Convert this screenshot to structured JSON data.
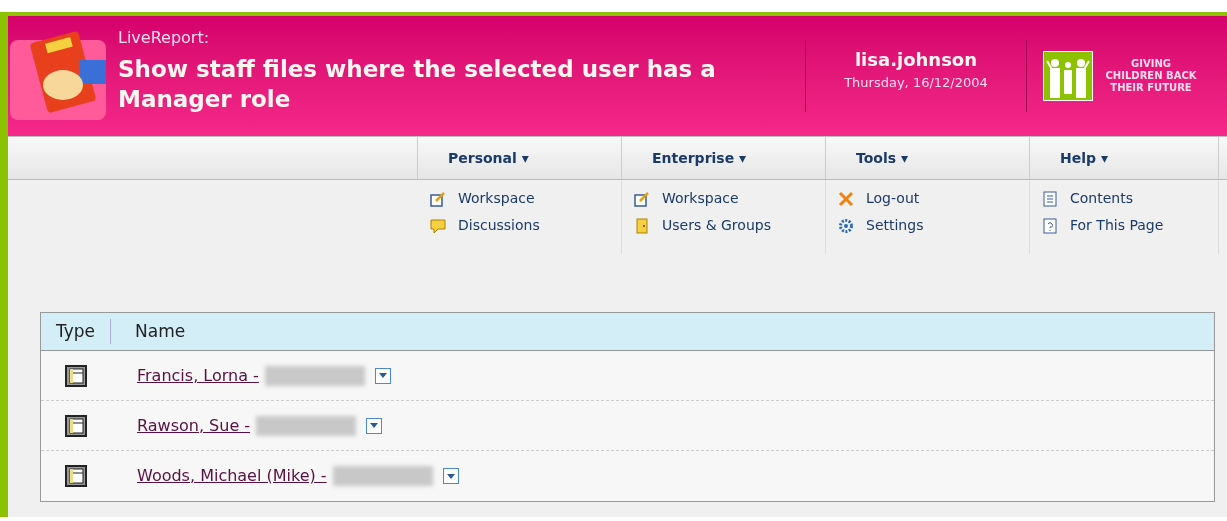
{
  "header": {
    "app": "LiveReport:",
    "title": "Show staff files where the selected user has a Manager role",
    "user": "lisa.johnson",
    "date": "Thursday, 16/12/2004",
    "logo_text": "GIVING CHILDREN BACK THEIR FUTURE"
  },
  "menus": [
    {
      "label": "Personal ▾",
      "items": [
        {
          "label": "Workspace"
        },
        {
          "label": "Discussions"
        }
      ]
    },
    {
      "label": "Enterprise ▾",
      "items": [
        {
          "label": "Workspace"
        },
        {
          "label": "Users & Groups"
        }
      ]
    },
    {
      "label": "Tools ▾",
      "items": [
        {
          "label": "Log-out"
        },
        {
          "label": "Settings"
        }
      ]
    },
    {
      "label": "Help ▾",
      "items": [
        {
          "label": "Contents"
        },
        {
          "label": "For This Page"
        }
      ]
    }
  ],
  "table": {
    "columns": [
      "Type",
      "Name"
    ],
    "rows": [
      {
        "name": "Francis, Lorna -"
      },
      {
        "name": "Rawson, Sue -"
      },
      {
        "name": "Woods, Michael (Mike) -"
      }
    ]
  }
}
